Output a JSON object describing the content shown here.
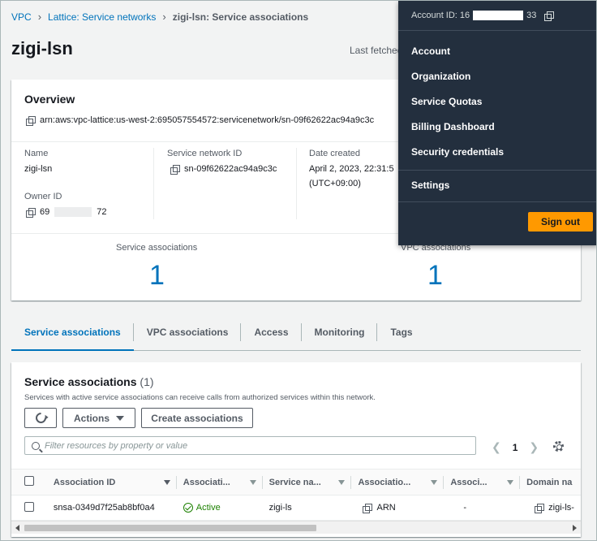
{
  "breadcrumb": {
    "items": [
      "VPC",
      "Lattice: Service networks"
    ],
    "current": "zigi-lsn: Service associations"
  },
  "page": {
    "title": "zigi-lsn",
    "last_fetched": "Last fetched"
  },
  "overview": {
    "heading": "Overview",
    "arn": "arn:aws:vpc-lattice:us-west-2:695057554572:servicenetwork/sn-09f62622ac94a9c3c",
    "name_label": "Name",
    "name_value": "zigi-lsn",
    "owner_label": "Owner ID",
    "owner_prefix": "69",
    "owner_suffix": "72",
    "sn_id_label": "Service network ID",
    "sn_id_value": "sn-09f62622ac94a9c3c",
    "date_label": "Date created",
    "date_value_line1": "April 2, 2023, 22:31:5",
    "date_value_line2": "(UTC+09:00)",
    "stat1_label": "Service associations",
    "stat1_value": "1",
    "stat2_label": "VPC associations",
    "stat2_value": "1"
  },
  "tabs": [
    {
      "label": "Service associations",
      "active": true
    },
    {
      "label": "VPC associations",
      "active": false
    },
    {
      "label": "Access",
      "active": false
    },
    {
      "label": "Monitoring",
      "active": false
    },
    {
      "label": "Tags",
      "active": false
    }
  ],
  "assoc": {
    "heading": "Service associations",
    "count": "(1)",
    "description": "Services with active service associations can receive calls from authorized services within this network.",
    "actions_label": "Actions",
    "create_label": "Create associations",
    "search_placeholder": "Filter resources by property or value",
    "page_number": "1",
    "columns": [
      "Association ID",
      "Associati...",
      "Service na...",
      "Associatio...",
      "Associ...",
      "Domain na"
    ],
    "row": {
      "id": "snsa-0349d7f25ab8bf0a4",
      "status": "Active",
      "service": "zigi-ls",
      "assoc_type": "ARN",
      "assoc_other": "-",
      "domain": "zigi-ls-"
    }
  },
  "account_menu": {
    "account_prefix": "Account ID: 16",
    "account_suffix": "33",
    "items": [
      "Account",
      "Organization",
      "Service Quotas",
      "Billing Dashboard",
      "Security credentials"
    ],
    "settings": "Settings",
    "signout": "Sign out"
  },
  "colors": {
    "link": "#0073bb",
    "menu_bg": "#232f3e",
    "signout_bg": "#ff9900",
    "active_status": "#1d8102"
  }
}
